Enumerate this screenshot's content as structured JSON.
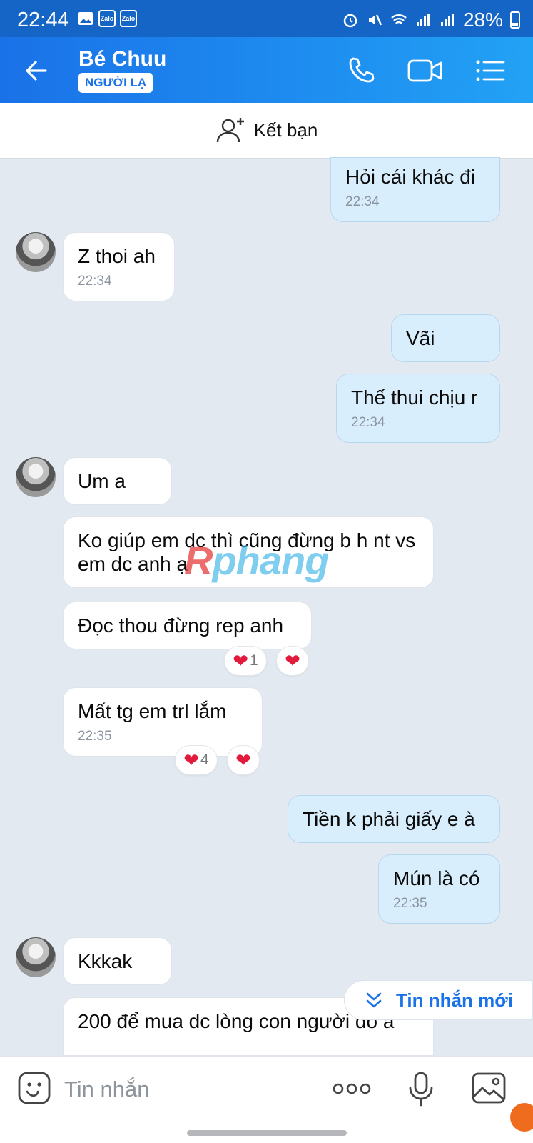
{
  "status": {
    "time": "22:44",
    "battery": "28%",
    "notif1": "Zalo",
    "notif2": "Zalo"
  },
  "header": {
    "title": "Bé Chuu",
    "badge": "NGƯỜI LẠ"
  },
  "add_friend": {
    "label": "Kết bạn"
  },
  "messages": [
    {
      "dir": "out",
      "text": "Hỏi cái khác đi",
      "time": "22:34"
    },
    {
      "dir": "in",
      "text": "Z thoi ah",
      "time": "22:34"
    },
    {
      "dir": "out",
      "text": "Vãi"
    },
    {
      "dir": "out",
      "text": "Thế thui chịu r",
      "time": "22:34"
    },
    {
      "dir": "in",
      "text": "Um a"
    },
    {
      "dir": "in",
      "text": "Ko giúp em dc thì cũng đừng b h nt vs em dc anh ạ"
    },
    {
      "dir": "in",
      "text": "Đọc thou đừng rep anh",
      "reaction_count": "1"
    },
    {
      "dir": "in",
      "text": "Mất tg em trl lắm",
      "time": "22:35",
      "reaction_count": "4"
    },
    {
      "dir": "out",
      "text": "Tiền k phải giấy e à"
    },
    {
      "dir": "out",
      "text": "Mún là có",
      "time": "22:35"
    },
    {
      "dir": "in",
      "text": "Kkkak"
    },
    {
      "dir": "in",
      "text": "200 để mua dc lòng con người đó a"
    }
  ],
  "watermark": {
    "prefix": "R",
    "text": "phang"
  },
  "new_messages": {
    "label": "Tin nhắn mới"
  },
  "input": {
    "placeholder": "Tin nhắn"
  },
  "colors": {
    "header": "#1a72e8",
    "outgoing_bubble": "#d9eefc",
    "background": "#e2e9f1",
    "heart": "#e21b3c"
  }
}
